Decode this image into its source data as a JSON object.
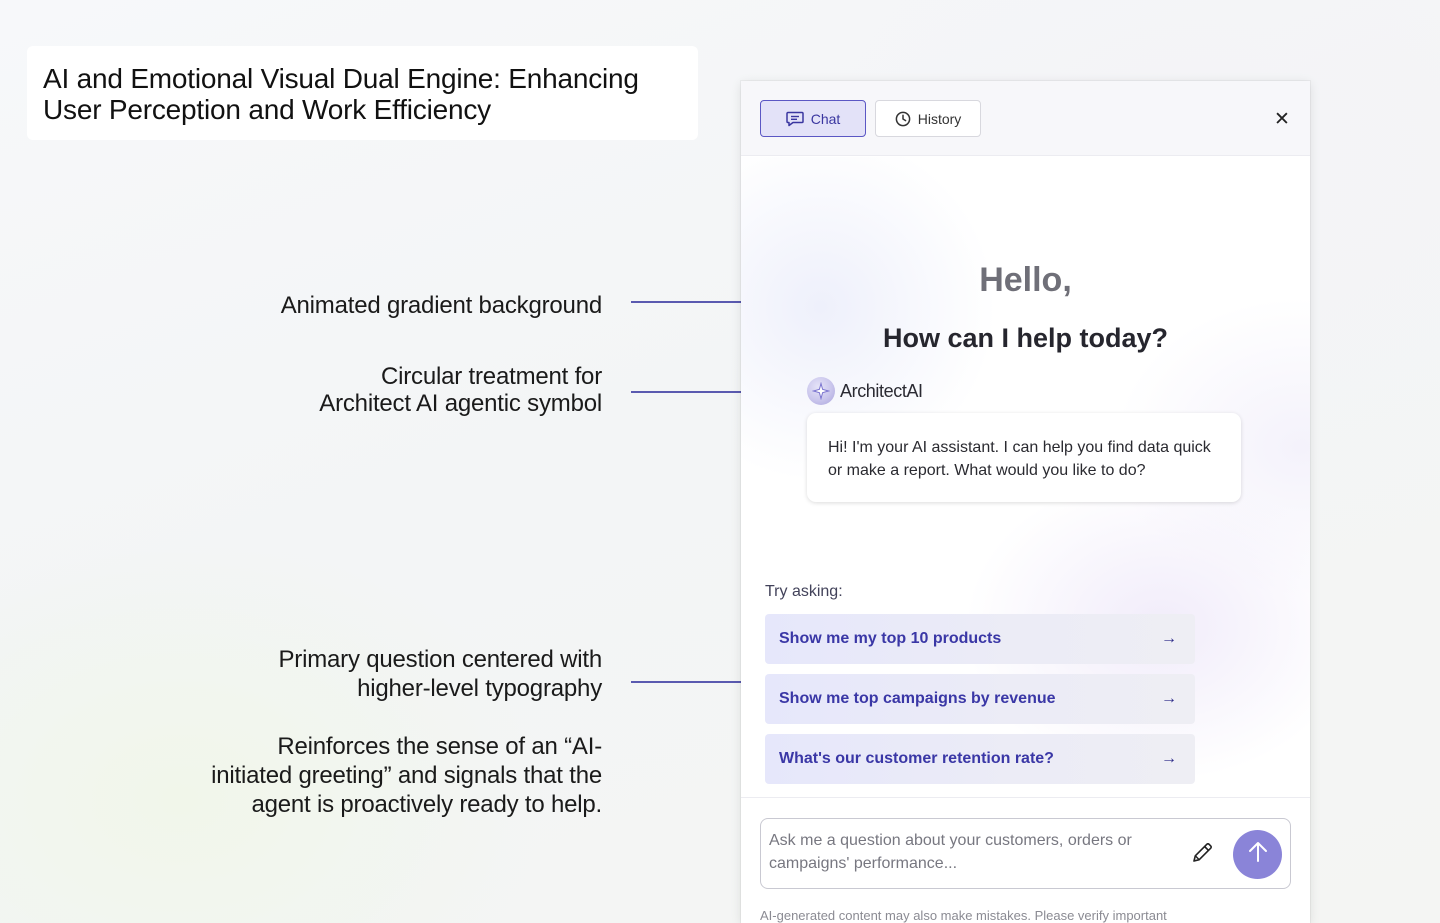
{
  "title": "AI and Emotional Visual Dual Engine: Enhancing User Perception and Work Efficiency",
  "annotations": {
    "gradient": "Animated gradient background",
    "circular_line1": "Circular treatment for",
    "circular_line2": "Architect AI agentic symbol",
    "primary_line1": "Primary question centered with",
    "primary_line2": "higher-level typography",
    "reinforce_line1": "Reinforces the sense of an “AI-",
    "reinforce_line2": "initiated greeting” and signals that the",
    "reinforce_line3": "agent is proactively ready to help."
  },
  "panel": {
    "tabs": [
      {
        "label": "Chat",
        "icon": "chat-icon",
        "active": true
      },
      {
        "label": "History",
        "icon": "clock-icon",
        "active": false
      }
    ],
    "close_icon": "✕",
    "hello": "Hello,",
    "help": "How can I help today?",
    "agent_name_prefix": "Architect",
    "agent_name_suffix": "AI",
    "bubble_text": "Hi! I'm your AI assistant. I can help you find data quick or make a report. What would you like to do?",
    "try_label": "Try asking:",
    "suggestions": [
      "Show me my top 10 products",
      "Show me top campaigns by revenue",
      "What's our customer retention rate?"
    ],
    "arrow": "→",
    "input_placeholder": "Ask me a question about your customers, orders or campaigns' performance...",
    "disclaimer": "AI-generated content may also make mistakes. Please verify important"
  },
  "colors": {
    "accent": "#5b57c4",
    "send_button": "#8a84d8",
    "annotation_line": "#5a5ab0"
  }
}
